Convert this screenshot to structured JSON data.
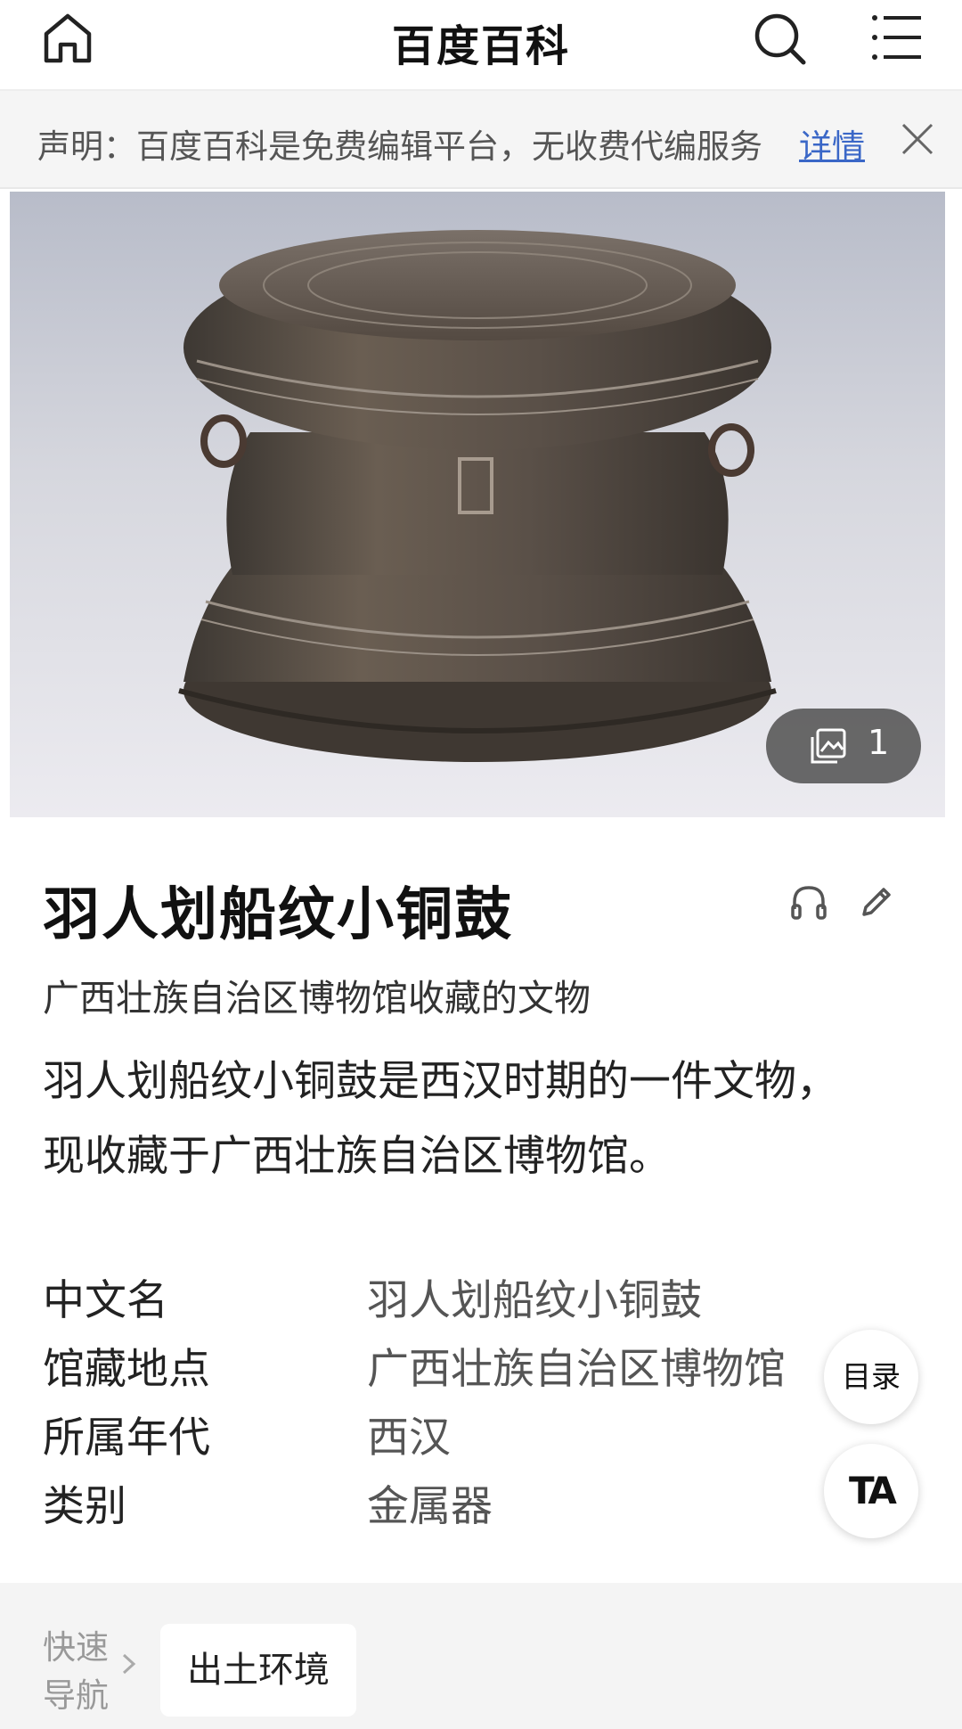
{
  "header": {
    "title": "百度百科",
    "home_icon": "home-icon",
    "search_icon": "search-icon",
    "menu_icon": "menu-icon"
  },
  "notice": {
    "text": "声明：百度百科是免费编辑平台，无收费代编服务",
    "link": "详情",
    "close_icon": "close-icon"
  },
  "hero": {
    "photo_count": "1",
    "photo_icon": "gallery-icon"
  },
  "entry": {
    "title": "羽人划船纹小铜鼓",
    "subtitle": "广西壮族自治区博物馆收藏的文物",
    "summary_lines": [
      "羽人划船纹小铜鼓是西汉时期的一件文物，",
      "现收藏于广西壮族自治区博物馆。"
    ]
  },
  "info": [
    {
      "key": "中文名",
      "value": "羽人划船纹小铜鼓"
    },
    {
      "key": "馆藏地点",
      "value": "广西壮族自治区博物馆"
    },
    {
      "key": "所属年代",
      "value": "西汉"
    },
    {
      "key": "类别",
      "value": "金属器"
    }
  ],
  "floating": {
    "toc": "目录",
    "font": "TA"
  },
  "quicknav": {
    "label_line1": "快速",
    "label_line2": "导航",
    "chip": "出土环境"
  },
  "colors": {
    "link": "#3a67c7",
    "notice_bg": "#f5f5f5",
    "quicknav_bg": "#f4f4f4"
  }
}
